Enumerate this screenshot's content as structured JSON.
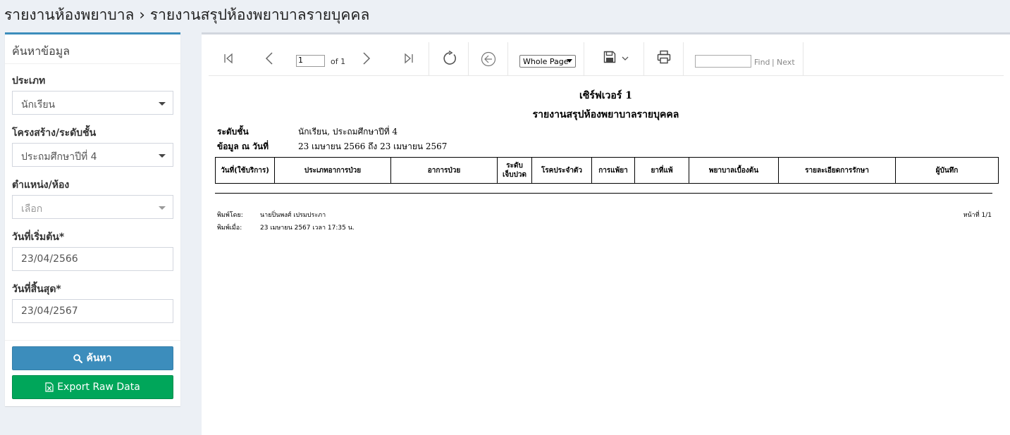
{
  "header": {
    "section": "รายงานห้องพยาบาล",
    "separator": "›",
    "page": "รายงานสรุปห้องพยาบาลรายบุคคล"
  },
  "search": {
    "title": "ค้นหาข้อมูล",
    "fields": [
      {
        "label": "ประเภท",
        "value": "นักเรียน"
      },
      {
        "label": "โครงสร้าง/ระดับชั้น",
        "value": "ประถมศึกษาปีที่ 4"
      },
      {
        "label": "ตำแหน่ง/ห้อง",
        "value": "เลือก"
      },
      {
        "label": "วันที่เริ่มต้น*",
        "value": "23/04/2566"
      },
      {
        "label": "วันที่สิ้นสุด*",
        "value": "23/04/2567"
      }
    ],
    "search_button": "ค้นหา",
    "export_button": "Export Raw Data"
  },
  "toolbar": {
    "page_value": "1",
    "of_label": "of 1",
    "zoom": "Whole Page",
    "find_label": "Find",
    "find_sep": "|",
    "next_label": "Next"
  },
  "report": {
    "title": "เซิร์ฟเวอร์ 1",
    "subtitle": "รายงานสรุปห้องพยาบาลรายบุคคล",
    "level_label": "ระดับชั้น",
    "level_value": "นักเรียน, ประถมศึกษาปีที่ 4",
    "date_label": "ข้อมูล ณ วันที่",
    "date_value": "23 เมษายน 2566 ถึง 23 เมษายน 2567",
    "columns": [
      "วันที่(ใช้บริการ)",
      "ประเภทอาการป่วย",
      "อาการป่วย",
      "ระดับ\nเจ็บปวด",
      "โรคประจำตัว",
      "การแพ้ยา",
      "ยาที่แพ้",
      "พยาบาลเบื้องต้น",
      "รายละเอียดการรักษา",
      "ผู้บันทึก"
    ],
    "footer": {
      "printed_by_label": "พิมพ์โดย:",
      "printed_by": "นายปิ่นพงศ์ เปรมประภา",
      "printed_at_label": "พิมพ์เมื่อ:",
      "printed_at": "23 เมษายน 2567 เวลา 17:35 น.",
      "page": "หน้าที่ 1/1"
    }
  }
}
